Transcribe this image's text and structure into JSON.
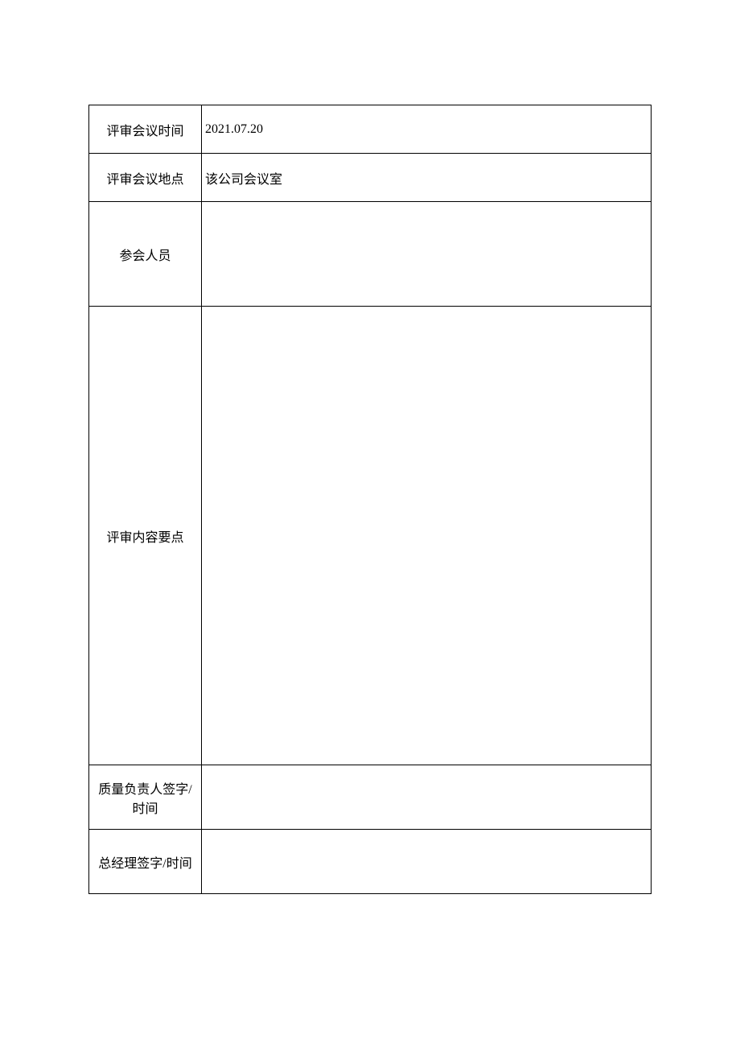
{
  "rows": {
    "meetingTime": {
      "label": "评审会议时间",
      "value": "2021.07.20"
    },
    "meetingLocation": {
      "label": "评审会议地点",
      "value": "该公司会议室"
    },
    "attendees": {
      "label": "参会人员",
      "value": ""
    },
    "reviewContent": {
      "label": "评审内容要点",
      "value": ""
    },
    "qualitySignature": {
      "label": "质量负责人签字/时间",
      "value": ""
    },
    "managerSignature": {
      "label": "总经理签字/时间",
      "value": ""
    }
  }
}
